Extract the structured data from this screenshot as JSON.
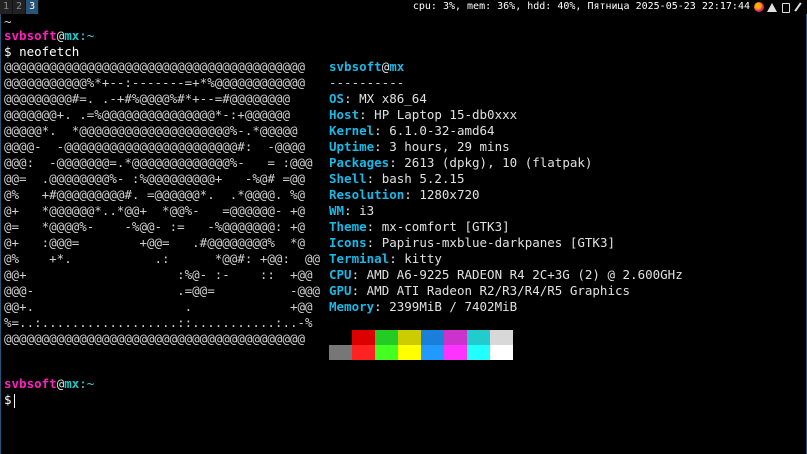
{
  "bar": {
    "workspaces": [
      "1",
      "2",
      "3"
    ],
    "status": "cpu: 3%, mem: 36%, hdd: 40%, Пятница 2025-05-23 22:17:44"
  },
  "terminal": {
    "tab_marker": "~",
    "prompt1": {
      "user": "svbsoft",
      "at": "@",
      "host": "mx",
      "dir": ":~",
      "sym": "$",
      "command": "neofetch"
    },
    "logo": [
      "@@@@@@@@@@@@@@@@@@@@@@@@@@@@@@@@@@@@@@@@",
      "@@@@@@@@@@@%*+--:-------=+*%@@@@@@@@@@@@",
      "@@@@@@@@@#=. .-+#%@@@@%#*+--=#@@@@@@@@",
      "@@@@@@@+. .=%@@@@@@@@@@@@@@@*-:+@@@@@@",
      "@@@@@*.  *@@@@@@@@@@@@@@@@@@@@%-.*@@@@@",
      "@@@@-  -@@@@@@@@@@@@@@@@@@@@@@@#:  -@@@@",
      "@@@:  -@@@@@@@=.*@@@@@@@@@@@@@%-   = :@@@",
      "@@=  .@@@@@@@@%- :%@@@@@@@@@+   -%@# =@@",
      "@%   +#@@@@@@@@@#. =@@@@@@*.  .*@@@@. %@",
      "@+   *@@@@@@*..*@@+  *@@%-   =@@@@@@- +@",
      "@=   *@@@@%-    -%@@- :=   -%@@@@@@@: +@",
      "@+   :@@@=        +@@=   .#@@@@@@@@%  *@",
      "@%    +*.           .:      *@@#: +@@:  @@",
      "@@+                    :%@- :-    ::  +@@",
      "@@@-                   .=@@=          -@@@",
      "@@+.                    .             +@@",
      "%=..:..................::...........:..-%",
      "@@@@@@@@@@@@@@@@@@@@@@@@@@@@@@@@@@@@@@@@"
    ],
    "info": {
      "user": "svbsoft",
      "at": "@",
      "host": "mx",
      "separator": "----------",
      "rows": [
        {
          "key": "OS",
          "value": "MX x86_64"
        },
        {
          "key": "Host",
          "value": "HP Laptop 15-db0xxx"
        },
        {
          "key": "Kernel",
          "value": "6.1.0-32-amd64"
        },
        {
          "key": "Uptime",
          "value": "3 hours, 29 mins"
        },
        {
          "key": "Packages",
          "value": "2613 (dpkg), 10 (flatpak)"
        },
        {
          "key": "Shell",
          "value": "bash 5.2.15"
        },
        {
          "key": "Resolution",
          "value": "1280x720"
        },
        {
          "key": "WM",
          "value": "i3"
        },
        {
          "key": "Theme",
          "value": "mx-comfort [GTK3]"
        },
        {
          "key": "Icons",
          "value": "Papirus-mxblue-darkpanes [GTK3]"
        },
        {
          "key": "Terminal",
          "value": "kitty"
        },
        {
          "key": "CPU",
          "value": "AMD A6-9225 RADEON R4 2C+3G (2) @ 2.600GHz"
        },
        {
          "key": "GPU",
          "value": "AMD ATI Radeon R2/R3/R4/R5 Graphics"
        },
        {
          "key": "Memory",
          "value": "2399MiB / 7402MiB"
        }
      ]
    },
    "palette": {
      "row1": [
        "#000000",
        "#dd0000",
        "#22cc22",
        "#cccc00",
        "#1a7fd8",
        "#cc33cc",
        "#22cccc",
        "#d8d8d8"
      ],
      "row2": [
        "#777777",
        "#ff2222",
        "#44ff22",
        "#ffff00",
        "#2299ff",
        "#ff33ff",
        "#22ffff",
        "#ffffff"
      ]
    },
    "prompt2": {
      "user": "svbsoft",
      "at": "@",
      "host": "mx",
      "dir": ":~",
      "sym": "$"
    }
  }
}
